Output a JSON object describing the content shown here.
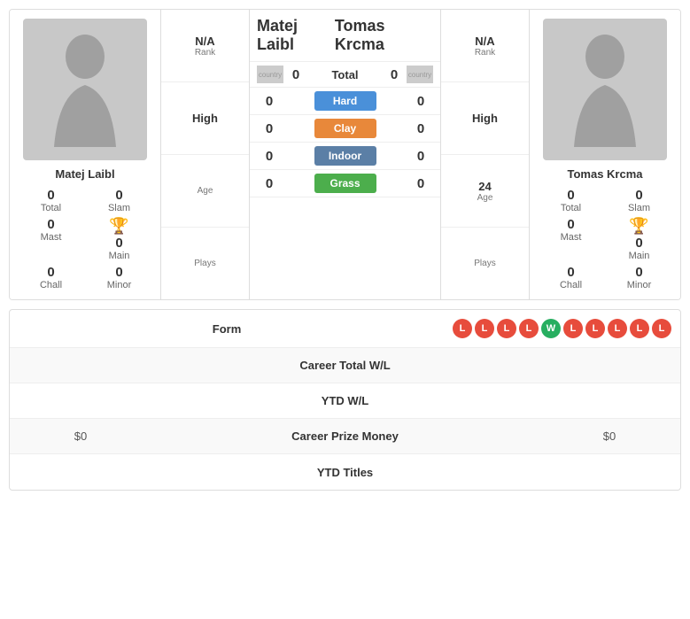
{
  "player1": {
    "name": "Matej Laibl",
    "stats": {
      "total": 0,
      "slam": 0,
      "mast": 0,
      "main": 0,
      "chall": 0,
      "minor": 0
    },
    "rank": "N/A",
    "high": "High",
    "age": "",
    "plays": ""
  },
  "player2": {
    "name": "Tomas Krcma",
    "stats": {
      "total": 0,
      "slam": 0,
      "mast": 0,
      "main": 0,
      "chall": 0,
      "minor": 0
    },
    "rank": "N/A",
    "high": "High",
    "age": 24,
    "plays": ""
  },
  "center": {
    "total_label": "Total",
    "total_left": 0,
    "total_right": 0,
    "surfaces": [
      {
        "name": "Hard",
        "badge": "hard",
        "left": 0,
        "right": 0
      },
      {
        "name": "Clay",
        "badge": "clay",
        "left": 0,
        "right": 0
      },
      {
        "name": "Indoor",
        "badge": "indoor",
        "left": 0,
        "right": 0
      },
      {
        "name": "Grass",
        "badge": "grass",
        "left": 0,
        "right": 0
      }
    ]
  },
  "bottom": {
    "form_label": "Form",
    "form": [
      "L",
      "L",
      "L",
      "L",
      "W",
      "L",
      "L",
      "L",
      "L",
      "L"
    ],
    "career_wl_label": "Career Total W/L",
    "ytd_wl_label": "YTD W/L",
    "career_prize_label": "Career Prize Money",
    "player1_prize": "$0",
    "player2_prize": "$0",
    "ytd_titles_label": "YTD Titles"
  },
  "labels": {
    "rank": "Rank",
    "high": "High",
    "age": "Age",
    "plays": "Plays",
    "total": "Total",
    "slam": "Slam",
    "mast": "Mast",
    "main": "Main",
    "chall": "Chall",
    "minor": "Minor"
  }
}
